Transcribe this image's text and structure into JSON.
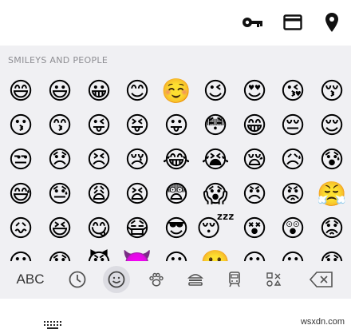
{
  "top_bar": {
    "icons": [
      "key-icon",
      "card-icon",
      "location-pin-icon"
    ]
  },
  "panel": {
    "section_title": "SMILEYS AND PEOPLE"
  },
  "emojis": [
    [
      "😄",
      "😃",
      "😀",
      "😊",
      "☺️",
      "😉",
      "😍",
      "😘",
      "😚"
    ],
    [
      "😗",
      "😙",
      "😜",
      "😝",
      "😛",
      "😳",
      "😁",
      "😔",
      "😌"
    ],
    [
      "😒",
      "😞",
      "😣",
      "😢",
      "😂",
      "😭",
      "😪",
      "😥",
      "😰"
    ],
    [
      "😅",
      "😓",
      "😩",
      "😫",
      "😨",
      "😱",
      "😠",
      "😡",
      "😤"
    ],
    [
      "😖",
      "😆",
      "😋",
      "😷",
      "😎",
      "😴",
      "😵",
      "😲",
      "😟"
    ],
    [
      "😦",
      "😧",
      "😈",
      "👿",
      "😮",
      "😬",
      "😐",
      "😕",
      "😯"
    ]
  ],
  "category_bar": {
    "abc_label": "ABC",
    "icons": [
      "clock-icon",
      "smiley-icon",
      "paw-icon",
      "burger-icon",
      "train-icon",
      "symbols-icon",
      "backspace-icon"
    ],
    "active": "smiley-icon"
  },
  "bottom_bar": {
    "watermark": "wsxdn.com",
    "icons": [
      "keyboard-icon"
    ]
  },
  "colors": {
    "panel_bg": "#f0f0f3",
    "accent_dark": "#111111",
    "category_gray": "#555555"
  }
}
